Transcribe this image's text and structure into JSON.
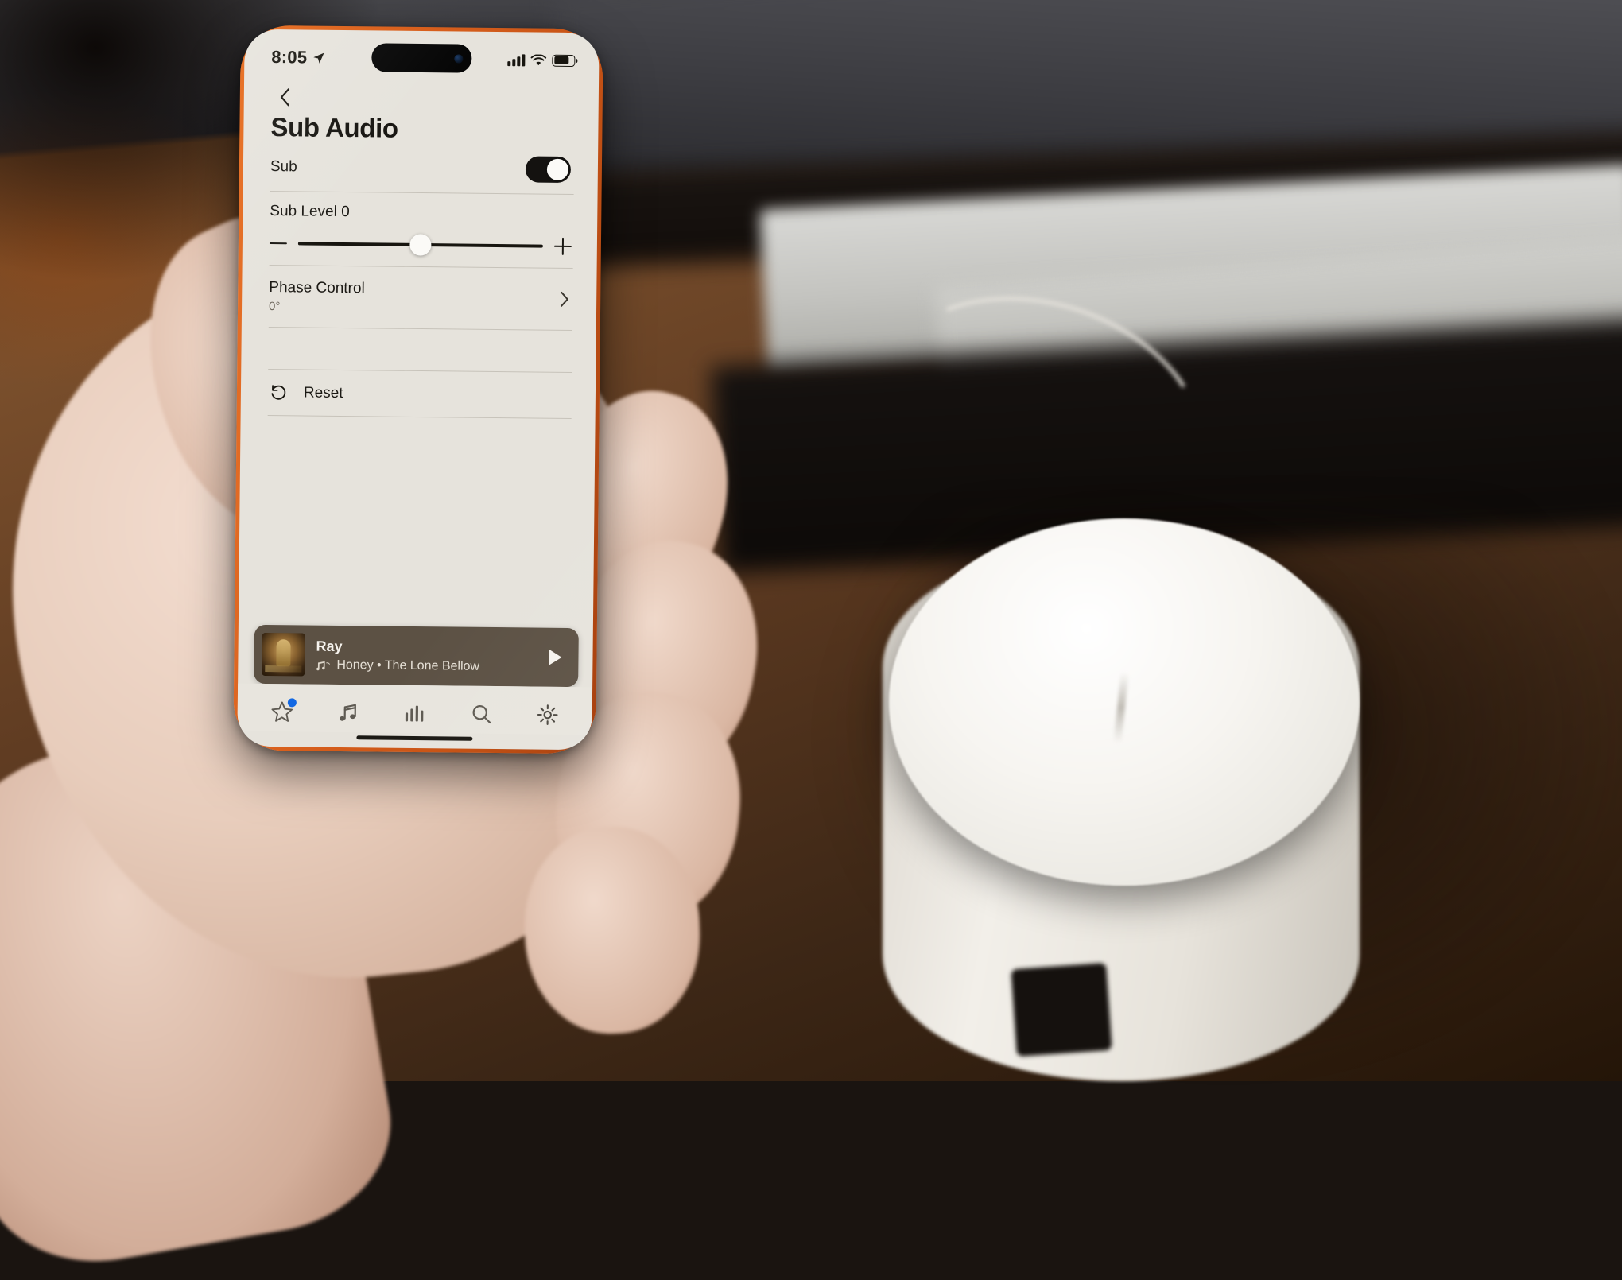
{
  "status_bar": {
    "time": "8:05",
    "location_icon": "location-arrow-icon",
    "signal_icon": "cellular-signal-icon",
    "wifi_icon": "wifi-icon",
    "battery_icon": "battery-icon"
  },
  "nav": {
    "back_icon": "chevron-left-icon"
  },
  "page": {
    "title": "Sub Audio"
  },
  "settings": {
    "sub": {
      "label": "Sub",
      "toggle_state": "on"
    },
    "sub_level": {
      "label": "Sub Level 0",
      "value": 0,
      "minus_icon": "minus-icon",
      "plus_icon": "plus-icon"
    },
    "phase_control": {
      "label": "Phase Control",
      "value": "0°",
      "chevron_icon": "chevron-right-icon"
    },
    "reset": {
      "label": "Reset",
      "icon": "undo-arrow-icon"
    }
  },
  "now_playing": {
    "title": "Ray",
    "source_icon": "apple-music-icon",
    "subtitle": "Honey • The Lone Bellow",
    "play_icon": "play-icon",
    "artwork": "album-artwork"
  },
  "tab_bar": {
    "tabs": [
      {
        "name": "favorites",
        "icon": "star-icon",
        "badge": true
      },
      {
        "name": "browse",
        "icon": "music-note-icon",
        "badge": false
      },
      {
        "name": "levels",
        "icon": "equalizer-bars-icon",
        "badge": false
      },
      {
        "name": "search",
        "icon": "search-icon",
        "badge": false
      },
      {
        "name": "settings",
        "icon": "gear-icon",
        "badge": false
      }
    ]
  },
  "theme": {
    "screen_bg": "#e6e3dc",
    "text": "#1a1813",
    "case_orange": "#d9601d",
    "now_playing_bg": "#5c5144",
    "badge_blue": "#1268e3"
  }
}
